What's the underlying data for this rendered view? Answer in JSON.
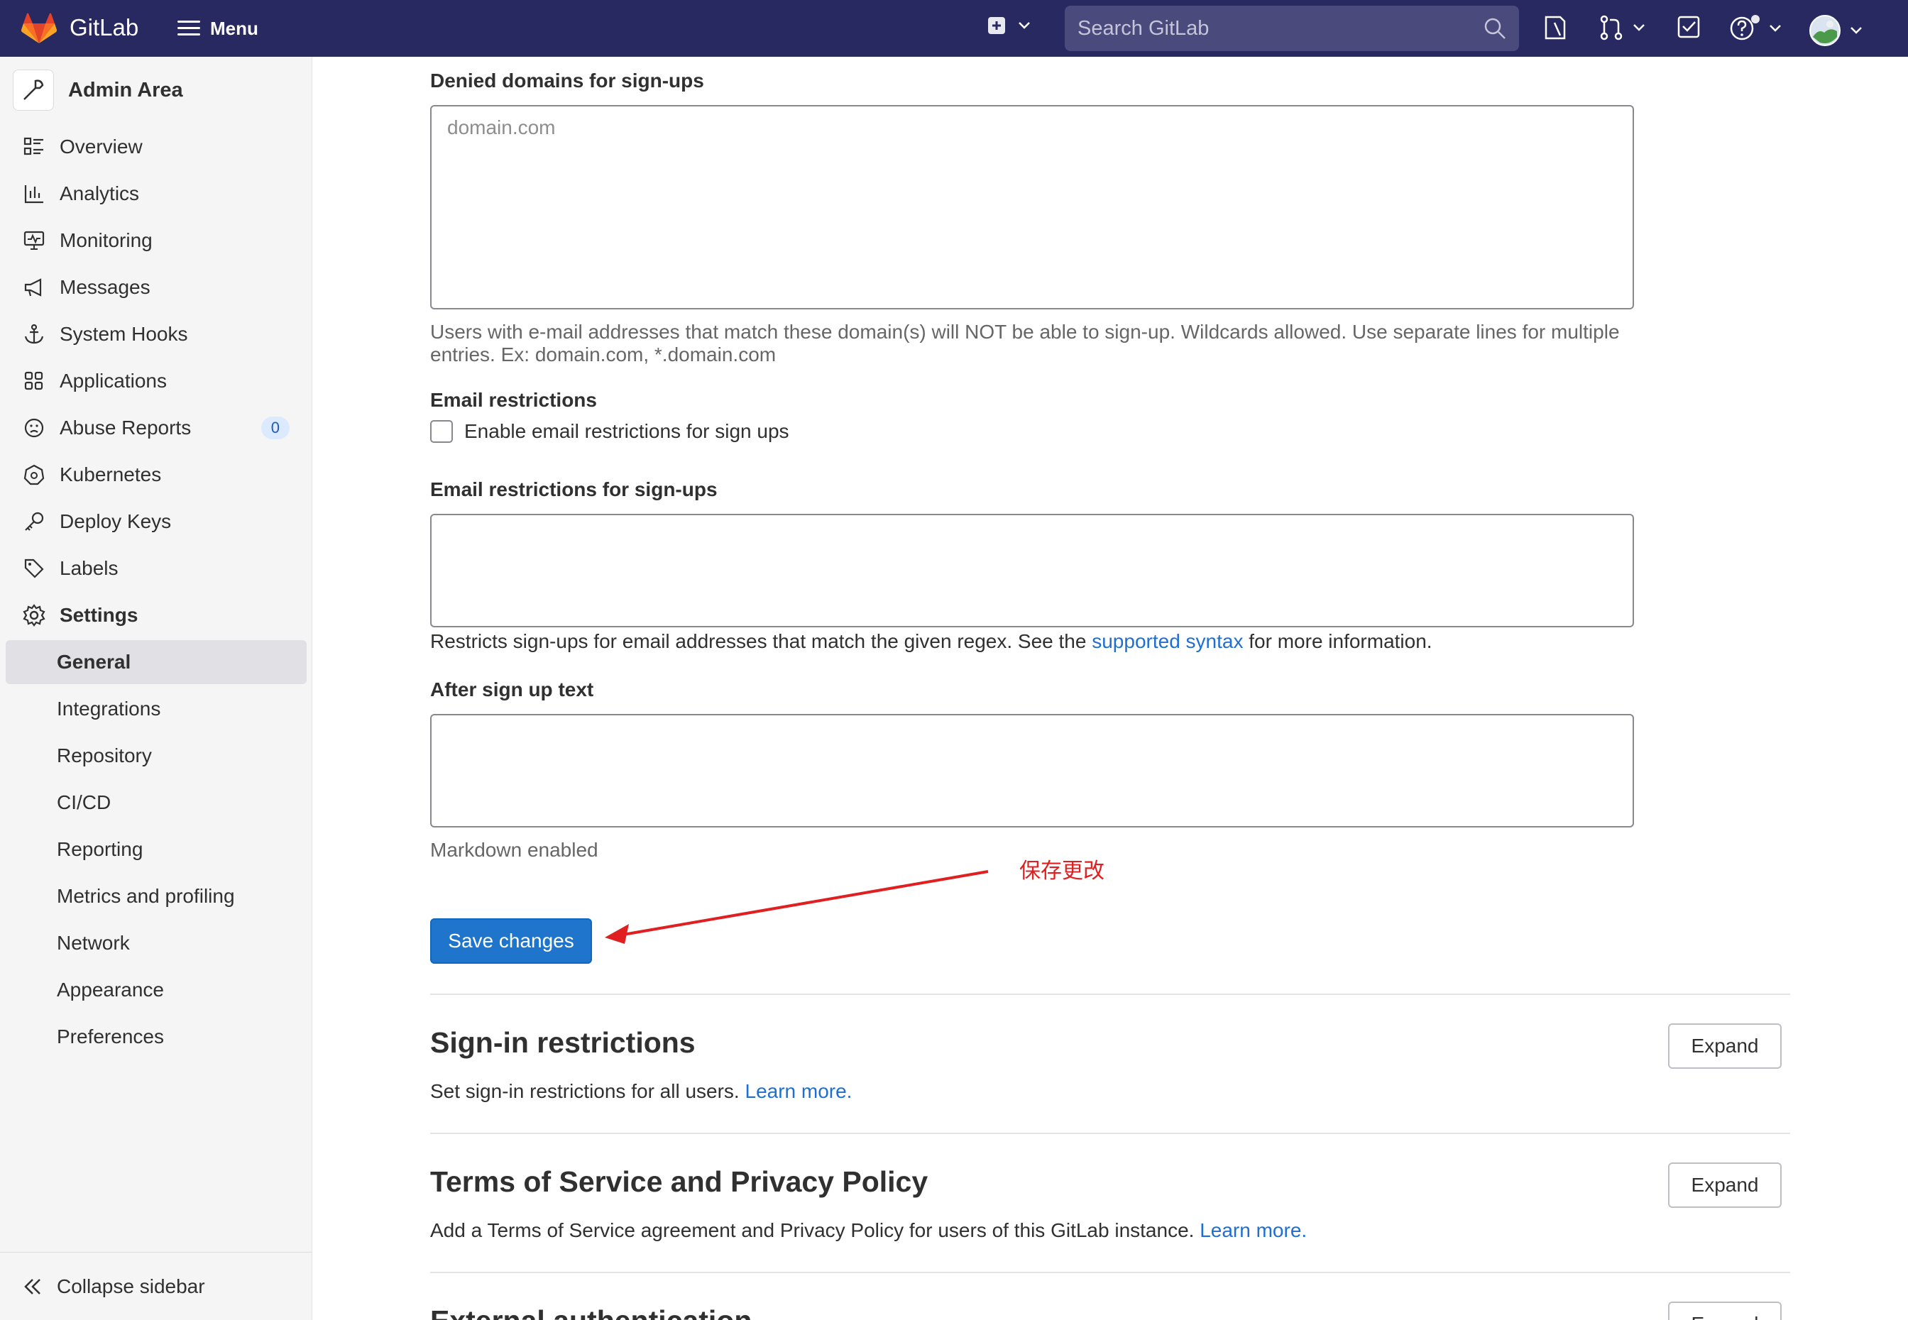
{
  "colors": {
    "navbar": "#292961",
    "accent": "#1f75cb",
    "link": "#1f6fd1",
    "annotation": "#e02020"
  },
  "topbar": {
    "brand": "GitLab",
    "menu_label": "Menu",
    "search_placeholder": "Search GitLab",
    "icons": [
      "gitlab-logo-icon",
      "plus-square-icon",
      "issues-icon",
      "merge-request-icon",
      "todo-icon",
      "help-icon",
      "avatar"
    ]
  },
  "sidebar": {
    "title": "Admin Area",
    "items": [
      {
        "label": "Overview",
        "icon": "overview-icon"
      },
      {
        "label": "Analytics",
        "icon": "analytics-icon"
      },
      {
        "label": "Monitoring",
        "icon": "monitor-icon"
      },
      {
        "label": "Messages",
        "icon": "megaphone-icon"
      },
      {
        "label": "System Hooks",
        "icon": "anchor-icon"
      },
      {
        "label": "Applications",
        "icon": "applications-icon"
      },
      {
        "label": "Abuse Reports",
        "icon": "abuse-icon",
        "count": "0"
      },
      {
        "label": "Kubernetes",
        "icon": "kubernetes-icon"
      },
      {
        "label": "Deploy Keys",
        "icon": "key-icon"
      },
      {
        "label": "Labels",
        "icon": "label-icon"
      },
      {
        "label": "Settings",
        "icon": "settings-icon"
      }
    ],
    "settings_sub": [
      "General",
      "Integrations",
      "Repository",
      "CI/CD",
      "Reporting",
      "Metrics and profiling",
      "Network",
      "Appearance",
      "Preferences"
    ],
    "active_sub": "General",
    "collapse_label": "Collapse sidebar"
  },
  "form": {
    "denied_domains": {
      "label": "Denied domains for sign-ups",
      "placeholder": "domain.com",
      "help": "Users with e-mail addresses that match these domain(s) will NOT be able to sign-up. Wildcards allowed. Use separate lines for multiple entries. Ex: domain.com, *.domain.com"
    },
    "email_restrictions": {
      "label": "Email restrictions",
      "checkbox_label": "Enable email restrictions for sign ups",
      "checked": false
    },
    "email_restrictions_signups": {
      "label": "Email restrictions for sign-ups",
      "help_before": "Restricts sign-ups for email addresses that match the given regex. See the ",
      "help_link": "supported syntax",
      "help_after": " for more information."
    },
    "after_sign_up": {
      "label": "After sign up text",
      "help": "Markdown enabled"
    },
    "save_label": "Save changes",
    "annotation": "保存更改"
  },
  "sections": [
    {
      "title": "Sign-in restrictions",
      "desc": "Set sign-in restrictions for all users. ",
      "link": "Learn more.",
      "button": "Expand"
    },
    {
      "title": "Terms of Service and Privacy Policy",
      "desc": "Add a Terms of Service agreement and Privacy Policy for users of this GitLab instance. ",
      "link": "Learn more.",
      "button": "Expand"
    },
    {
      "title": "External authentication",
      "button": "Expand"
    }
  ]
}
